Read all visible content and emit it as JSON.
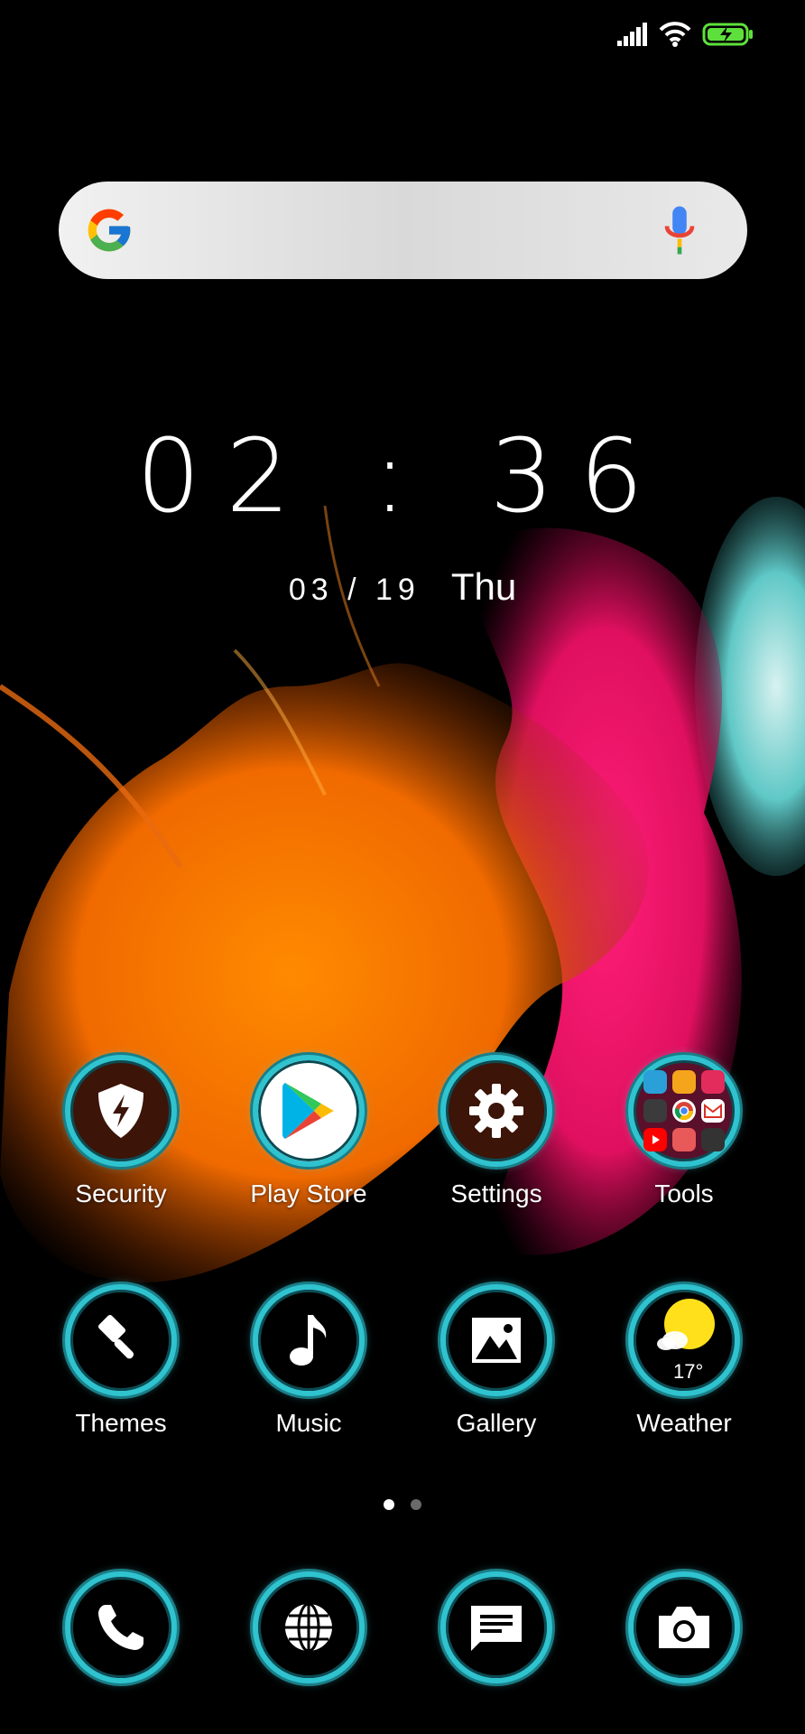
{
  "status_bar": {
    "signal_icon": "signal-bars-icon",
    "wifi_icon": "wifi-icon",
    "battery_icon": "battery-charging-icon",
    "accent_color": "#5ee03c"
  },
  "search": {
    "logo_icon": "google-g-icon",
    "mic_icon": "microphone-icon"
  },
  "clock": {
    "time": "02 : 36",
    "date": "03 / 19",
    "weekday": "Thu"
  },
  "apps_row1": [
    {
      "label": "Security",
      "icon": "shield-bolt-icon"
    },
    {
      "label": "Play Store",
      "icon": "play-store-icon"
    },
    {
      "label": "Settings",
      "icon": "gear-icon"
    },
    {
      "label": "Tools",
      "icon": "folder-icon"
    }
  ],
  "apps_row2": [
    {
      "label": "Themes",
      "icon": "paintbrush-icon"
    },
    {
      "label": "Music",
      "icon": "music-note-icon"
    },
    {
      "label": "Gallery",
      "icon": "image-icon"
    },
    {
      "label": "Weather",
      "icon": "sun-cloud-icon",
      "temperature": "17°"
    }
  ],
  "dock": [
    {
      "icon": "phone-icon"
    },
    {
      "icon": "globe-icon"
    },
    {
      "icon": "message-icon"
    },
    {
      "icon": "camera-icon"
    }
  ],
  "pages": {
    "count": 2,
    "active_index": 0
  },
  "colors": {
    "ring": "#2fc3cf",
    "accent_teal": "#1a7e87"
  }
}
